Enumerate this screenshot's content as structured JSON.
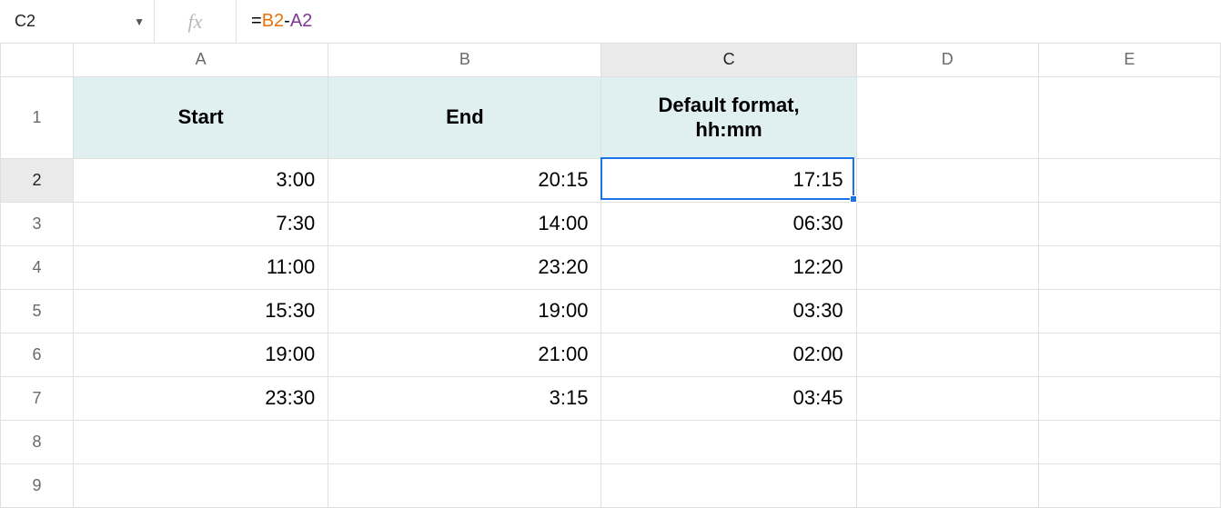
{
  "name_box": {
    "value": "C2"
  },
  "fx_label": "fx",
  "formula": {
    "prefix": "=",
    "ref_b": "B2",
    "op": "-",
    "ref_a": "A2"
  },
  "columns": [
    "A",
    "B",
    "C",
    "D",
    "E"
  ],
  "row_labels": [
    "1",
    "2",
    "3",
    "4",
    "5",
    "6",
    "7",
    "8",
    "9"
  ],
  "selected_col": "C",
  "selected_row": "2",
  "headers": {
    "A": "Start",
    "B": "End",
    "C": "Default format,\nhh:mm"
  },
  "rows": [
    {
      "A": "3:00",
      "B": "20:15",
      "C": "17:15"
    },
    {
      "A": "7:30",
      "B": "14:00",
      "C": "06:30"
    },
    {
      "A": "11:00",
      "B": "23:20",
      "C": "12:20"
    },
    {
      "A": "15:30",
      "B": "19:00",
      "C": "03:30"
    },
    {
      "A": "19:00",
      "B": "21:00",
      "C": "02:00"
    },
    {
      "A": "23:30",
      "B": "3:15",
      "C": "03:45"
    }
  ],
  "chart_data": {
    "type": "table",
    "title": "",
    "columns": [
      "Start",
      "End",
      "Default format, hh:mm"
    ],
    "rows": [
      [
        "3:00",
        "20:15",
        "17:15"
      ],
      [
        "7:30",
        "14:00",
        "06:30"
      ],
      [
        "11:00",
        "23:20",
        "12:20"
      ],
      [
        "15:30",
        "19:00",
        "03:30"
      ],
      [
        "19:00",
        "21:00",
        "02:00"
      ],
      [
        "23:30",
        "3:15",
        "03:45"
      ]
    ]
  }
}
